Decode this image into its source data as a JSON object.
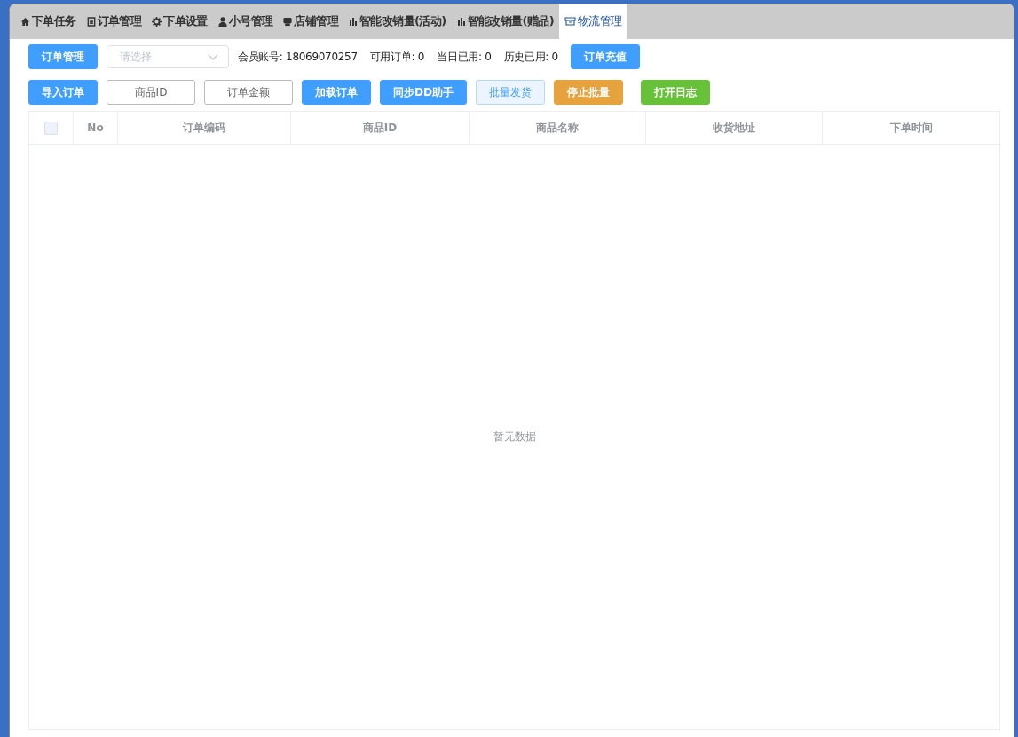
{
  "tabs": [
    {
      "label": "下单任务",
      "kind": "home",
      "selected": false
    },
    {
      "label": "订单管理",
      "kind": "doc",
      "selected": false
    },
    {
      "label": "下单设置",
      "kind": "gear",
      "selected": false
    },
    {
      "label": "小号管理",
      "kind": "user",
      "selected": false
    },
    {
      "label": "店铺管理",
      "kind": "store",
      "selected": false
    },
    {
      "label": "智能改销量(活动)",
      "kind": "chart",
      "selected": false
    },
    {
      "label": "智能改销量(赠品)",
      "kind": "chart",
      "selected": false
    },
    {
      "label": "物流管理",
      "kind": "box",
      "selected": true
    }
  ],
  "toolbar": {
    "manage_button": "订单管理",
    "select": {
      "placeholder": "请选择"
    },
    "stats": [
      "会员账号: 18069070257",
      "可用订单: 0",
      "当日已用: 0",
      "历史已用: 0"
    ],
    "recharge_button": "订单充值"
  },
  "actions": [
    {
      "label": "导入订单",
      "kind": "primary"
    },
    {
      "label": "商品ID",
      "kind": "plain"
    },
    {
      "label": "订单金额",
      "kind": "plain"
    },
    {
      "label": "加载订单",
      "kind": "primary"
    },
    {
      "label": "同步DD助手",
      "kind": "primary"
    },
    {
      "label": "批量发货",
      "kind": "light"
    },
    {
      "label": "停止批量",
      "kind": "warning"
    },
    {
      "label": "打开日志",
      "kind": "success"
    }
  ],
  "table": {
    "select_all": {
      "checked": false
    },
    "columns": [
      "No",
      "订单编码",
      "商品ID",
      "商品名称",
      "收货地址",
      "下单时间"
    ],
    "empty_text": "暂无数据"
  }
}
